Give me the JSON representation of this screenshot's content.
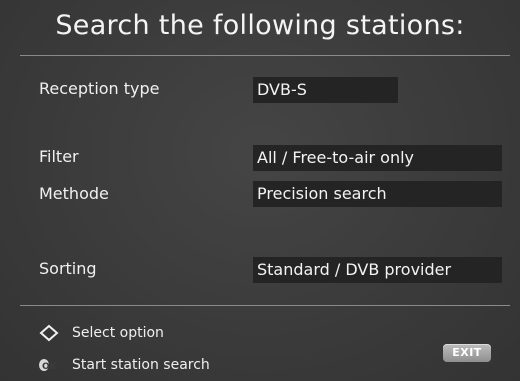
{
  "title": "Search the following stations:",
  "settings": [
    {
      "label": "Reception type",
      "value": "DVB-S"
    },
    {
      "label": "Filter",
      "value": "All  /  Free-to-air only"
    },
    {
      "label": "Methode",
      "value": "Precision search"
    },
    {
      "label": "Sorting",
      "value": "Standard  /  DVB provider"
    }
  ],
  "legend": {
    "select_option": "Select option",
    "start_search": "Start station search",
    "ok_icon_text": "OK"
  },
  "exit_button": "EXIT",
  "colors": {
    "background": "#3b3b3b",
    "value_box": "#242424",
    "text": "#f2f2f2",
    "divider": "#8a8a8a"
  }
}
